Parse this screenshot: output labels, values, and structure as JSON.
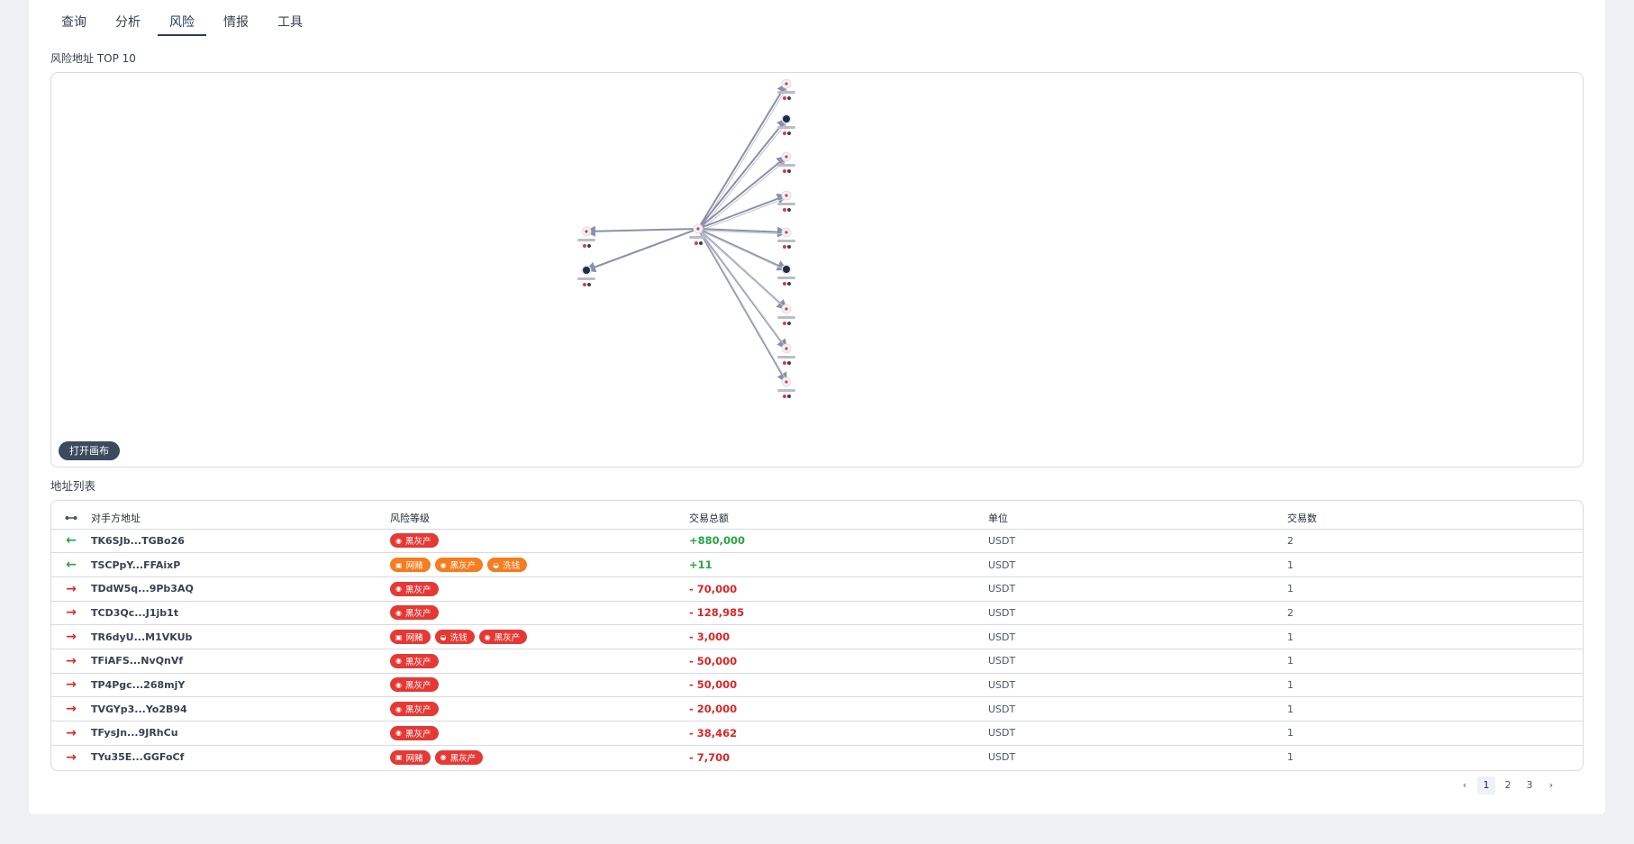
{
  "tabs": [
    {
      "label": "查询",
      "active": false
    },
    {
      "label": "分析",
      "active": false
    },
    {
      "label": "风险",
      "active": true
    },
    {
      "label": "情报",
      "active": false
    },
    {
      "label": "工具",
      "active": false
    }
  ],
  "graph": {
    "title": "风险地址 TOP 10",
    "open_canvas_label": "打开画布"
  },
  "table": {
    "title": "地址列表",
    "headers": {
      "direction_icon": "link-icon",
      "address": "对手方地址",
      "risk": "风险等级",
      "amount": "交易总额",
      "unit": "单位",
      "count": "交易数"
    },
    "rows": [
      {
        "direction": "in",
        "address": "TK6SJb...TGBo26",
        "tags": [
          {
            "label": "黑灰产",
            "color": "red",
            "icon": "mask-icon"
          }
        ],
        "amount": "+880,000",
        "unit": "USDT",
        "count": "2"
      },
      {
        "direction": "in",
        "address": "TSCPpY...FFAixP",
        "tags": [
          {
            "label": "网赌",
            "color": "orange",
            "icon": "dice-icon"
          },
          {
            "label": "黑灰产",
            "color": "orange",
            "icon": "mask-icon"
          },
          {
            "label": "洗钱",
            "color": "orange",
            "icon": "laundry-icon"
          }
        ],
        "amount": "+11",
        "unit": "USDT",
        "count": "1"
      },
      {
        "direction": "out",
        "address": "TDdW5q...9Pb3AQ",
        "tags": [
          {
            "label": "黑灰产",
            "color": "red",
            "icon": "mask-icon"
          }
        ],
        "amount": "- 70,000",
        "unit": "USDT",
        "count": "1"
      },
      {
        "direction": "out",
        "address": "TCD3Qc...J1jb1t",
        "tags": [
          {
            "label": "黑灰产",
            "color": "red",
            "icon": "mask-icon"
          }
        ],
        "amount": "- 128,985",
        "unit": "USDT",
        "count": "2"
      },
      {
        "direction": "out",
        "address": "TR6dyU...M1VKUb",
        "tags": [
          {
            "label": "网赌",
            "color": "red",
            "icon": "dice-icon"
          },
          {
            "label": "洗钱",
            "color": "red",
            "icon": "laundry-icon"
          },
          {
            "label": "黑灰产",
            "color": "red",
            "icon": "mask-icon"
          }
        ],
        "amount": "- 3,000",
        "unit": "USDT",
        "count": "1"
      },
      {
        "direction": "out",
        "address": "TFiAFS...NvQnVf",
        "tags": [
          {
            "label": "黑灰产",
            "color": "red",
            "icon": "mask-icon"
          }
        ],
        "amount": "- 50,000",
        "unit": "USDT",
        "count": "1"
      },
      {
        "direction": "out",
        "address": "TP4Pgc...268mjY",
        "tags": [
          {
            "label": "黑灰产",
            "color": "red",
            "icon": "mask-icon"
          }
        ],
        "amount": "- 50,000",
        "unit": "USDT",
        "count": "1"
      },
      {
        "direction": "out",
        "address": "TVGYp3...Yo2B94",
        "tags": [
          {
            "label": "黑灰产",
            "color": "red",
            "icon": "mask-icon"
          }
        ],
        "amount": "- 20,000",
        "unit": "USDT",
        "count": "1"
      },
      {
        "direction": "out",
        "address": "TFysJn...9JRhCu",
        "tags": [
          {
            "label": "黑灰产",
            "color": "red",
            "icon": "mask-icon"
          }
        ],
        "amount": "- 38,462",
        "unit": "USDT",
        "count": "1"
      },
      {
        "direction": "out",
        "address": "TYu35E...GGFoCf",
        "tags": [
          {
            "label": "网赌",
            "color": "red",
            "icon": "dice-icon"
          },
          {
            "label": "黑灰产",
            "color": "red",
            "icon": "mask-icon"
          }
        ],
        "amount": "- 7,700",
        "unit": "USDT",
        "count": "1"
      }
    ]
  },
  "pagination": {
    "prev": "‹",
    "pages": [
      "1",
      "2",
      "3"
    ],
    "current": "1",
    "next": "›"
  },
  "colors": {
    "tag_red": "#e53935",
    "tag_orange": "#f57c1f",
    "amount_positive": "#28a745",
    "amount_negative": "#dc2626",
    "edge": "#8a90a8"
  }
}
